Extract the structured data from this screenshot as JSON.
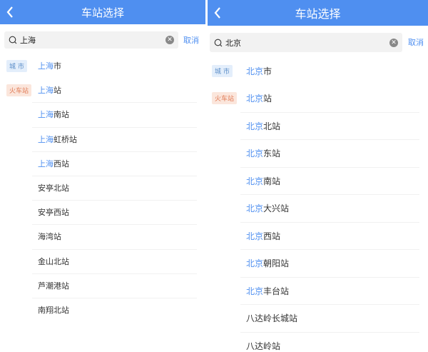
{
  "colors": {
    "accent": "#4f8ff0",
    "header": "#4f8ff0"
  },
  "left": {
    "title": "车站选择",
    "search_value": "上海",
    "cancel_label": "取消",
    "tags": {
      "city": "城 市",
      "train": "火车站"
    },
    "items": [
      {
        "match": "上海",
        "rest": "市",
        "tag": "city"
      },
      {
        "match": "上海",
        "rest": "站",
        "tag": "train"
      },
      {
        "match": "上海",
        "rest": "南站"
      },
      {
        "match": "上海",
        "rest": "虹桥站"
      },
      {
        "match": "上海",
        "rest": "西站"
      },
      {
        "match": "",
        "rest": "安亭北站"
      },
      {
        "match": "",
        "rest": "安亭西站"
      },
      {
        "match": "",
        "rest": "海湾站"
      },
      {
        "match": "",
        "rest": "金山北站"
      },
      {
        "match": "",
        "rest": "芦潮港站"
      },
      {
        "match": "",
        "rest": "南翔北站"
      }
    ]
  },
  "right": {
    "title": "车站选择",
    "search_value": "北京",
    "cancel_label": "取消",
    "tags": {
      "city": "城 市",
      "train": "火车站"
    },
    "items": [
      {
        "match": "北京",
        "rest": "市",
        "tag": "city"
      },
      {
        "match": "北京",
        "rest": "站",
        "tag": "train"
      },
      {
        "match": "北京",
        "rest": "北站"
      },
      {
        "match": "北京",
        "rest": "东站"
      },
      {
        "match": "北京",
        "rest": "南站"
      },
      {
        "match": "北京",
        "rest": "大兴站"
      },
      {
        "match": "北京",
        "rest": "西站"
      },
      {
        "match": "北京",
        "rest": "朝阳站"
      },
      {
        "match": "北京",
        "rest": "丰台站"
      },
      {
        "match": "",
        "rest": "八达岭长城站"
      },
      {
        "match": "",
        "rest": "八达岭站"
      }
    ]
  }
}
